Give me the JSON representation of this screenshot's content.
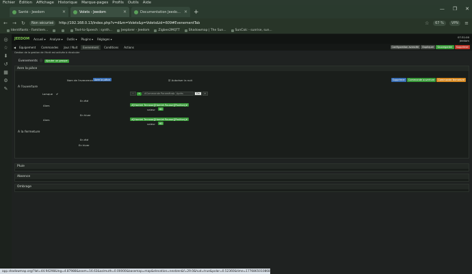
{
  "menu": [
    "Fichier",
    "Édition",
    "Affichage",
    "Historique",
    "Marque-pages",
    "Profils",
    "Outils",
    "Aide"
  ],
  "tabs": [
    {
      "label": "Santé - Jeedom",
      "active": false
    },
    {
      "label": "Volets - Jeedom",
      "active": true
    },
    {
      "label": "Documentation Jeedom | Gesti",
      "active": false
    }
  ],
  "new_tab": "+",
  "window_controls": [
    "—",
    "❐",
    "✕"
  ],
  "address": {
    "secure": "Non sécurisé",
    "url": "http://192.168.0.13/index.php?v=d&m=Volets&p=Volets&id=609#EvenementTab",
    "zoom": "67 %",
    "vpn": "VPN"
  },
  "bookmarks": [
    "Identifiants - Familiem...",
    "",
    "",
    "Text-to-Speech : synth...",
    "Jeeplorer - Jeedom",
    "Zigbee2MQTT",
    "Shadowmap | The Sun...",
    "SunCalc - sunrise, sun..."
  ],
  "sidebar_icons": [
    "◎",
    "☆",
    "⬇",
    "↺",
    "▦",
    "⚙",
    "✎"
  ],
  "jeedom": {
    "logo": "JEEDOM",
    "nav": [
      "Accueil ▾",
      "Analyse ▾",
      "Outils ▾",
      "Plugins ▾",
      "Réglages ▾"
    ],
    "time": "07:31:00",
    "date": "Jeedom"
  },
  "subtabs": [
    "Equipement",
    "Commandes",
    "Jour / Nuit",
    "Evenement",
    "Conditions",
    "Actions"
  ],
  "active_subtab": 3,
  "actions": [
    {
      "label": "Configuration avancée",
      "class": "bgray"
    },
    {
      "label": "Dupliquer",
      "class": "bgray"
    },
    {
      "label": "Sauvegarder",
      "class": "bgreen"
    },
    {
      "label": "Supprimer",
      "class": "bred"
    }
  ],
  "hint": "Gestion de la gestion de l'écrit est activée à récalculer",
  "evenements": {
    "label": "Evenements",
    "add": "Ajouter un groupe"
  },
  "groupe": {
    "title": "Aere la pièce",
    "nom_label": "Nom de l'evenement",
    "nom_value": "Aere la pièce",
    "autoriser": "Autoriser la nuit",
    "btns": [
      {
        "label": "Supprimer",
        "class": "bblue"
      },
      {
        "label": "Commande ouverture",
        "class": "bgreen"
      },
      {
        "label": "Commande fermeture",
        "class": "borange"
      }
    ],
    "ouverture": {
      "title": "A l'ouverture",
      "lorsque": "Lorsque",
      "etat": "#Commande Paramétrable",
      "aps": "Après",
      "qui": "On",
      "ete_label": "En été",
      "alors": "Alors",
      "cmd": "#[Hamlet Terrasse][Hamlet Rousse][Position]#",
      "valeur": "valeur",
      "val": "60",
      "hiver_label": "En hiver",
      "alors2": "Alors",
      "cmd2": "#[Hamlet Terrasse][Hamlet Rousse][Position]#",
      "valeur2": "valeur",
      "val2": "60"
    },
    "fermeture": {
      "title": "A la fermeture",
      "ete_label": "En été",
      "hiver_label": "En hiver"
    }
  },
  "sections": [
    "Pluie",
    "Absence",
    "Ombrage"
  ],
  "statusbar": "app.shadowmap.org/?lat=44.94298&lng=4.87988&zoom=16.63&azimuth=0.00000&basemap=map&elevation=nextzen&f=29.0&hud=true&polar=0.52360&time=1776865010868&vq=2"
}
